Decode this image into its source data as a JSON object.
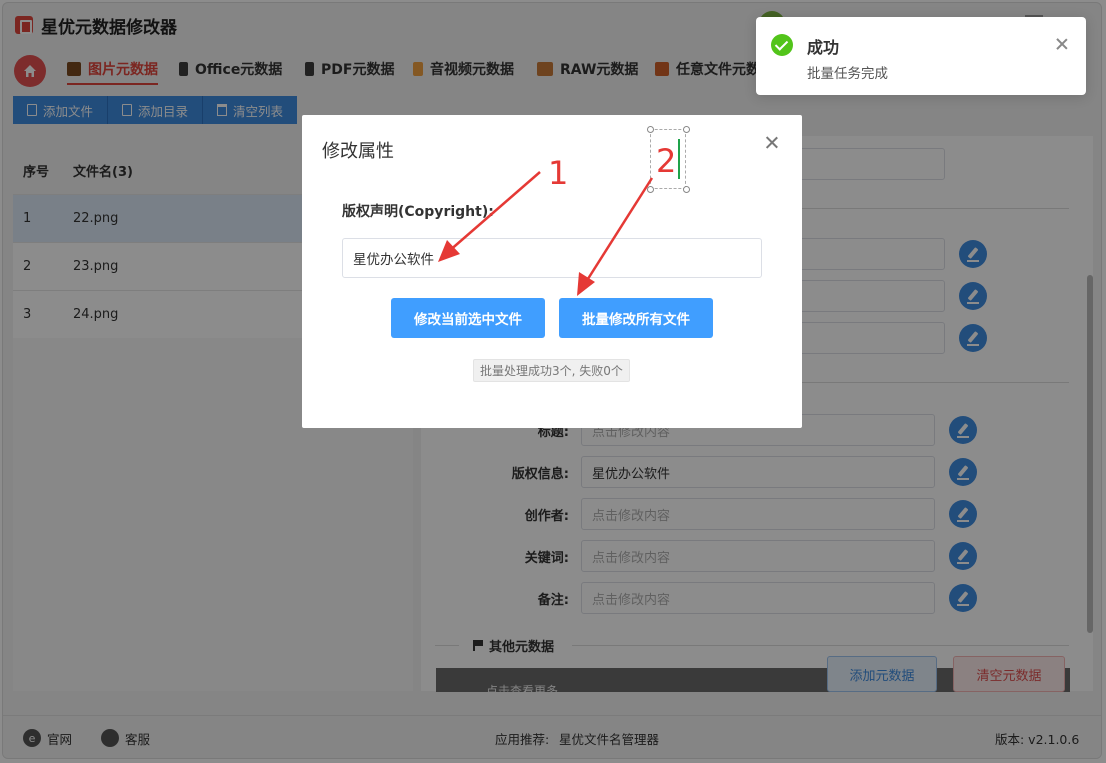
{
  "app": {
    "title": "星优元数据修改器"
  },
  "tabs": [
    {
      "label": "图片元数据",
      "icon": "image-icon",
      "color": "#e0463c"
    },
    {
      "label": "Office元数据",
      "icon": "office-icon",
      "color": "#333333"
    },
    {
      "label": "PDF元数据",
      "icon": "pdf-icon",
      "color": "#333333"
    },
    {
      "label": "音视频元数据",
      "icon": "media-icon",
      "color": "#333333"
    },
    {
      "label": "RAW元数据",
      "icon": "raw-icon",
      "color": "#333333"
    },
    {
      "label": "任意文件元数",
      "icon": "file-icon",
      "color": "#333333"
    }
  ],
  "toolbar": {
    "add_file": "添加文件",
    "add_dir": "添加目录",
    "clear_list": "清空列表"
  },
  "file_table": {
    "headers": [
      "序号",
      "文件名(3)"
    ],
    "rows": [
      {
        "index": "1",
        "name": "22.png"
      },
      {
        "index": "2",
        "name": "23.png"
      },
      {
        "index": "3",
        "name": "24.png"
      }
    ]
  },
  "fields": {
    "title_label": "标题:",
    "title_placeholder": "点击修改内容",
    "copyright_label": "版权信息:",
    "copyright_value": "星优办公软件",
    "author_label": "创作者:",
    "author_placeholder": "点击修改内容",
    "keywords_label": "关键词:",
    "keywords_placeholder": "点击修改内容",
    "notes_label": "备注:",
    "notes_placeholder": "点击修改内容"
  },
  "other_section": {
    "title": "其他元数据",
    "bar_text": "点击查看更多",
    "add_button": "添加元数据",
    "clear_button": "清空元数据"
  },
  "statusbar": {
    "website": "官网",
    "support": "客服",
    "recommend_label": "应用推荐:",
    "recommend_app": "星优文件名管理器",
    "version": "版本: v2.1.0.6"
  },
  "modal": {
    "title": "修改属性",
    "field_label": "版权声明(Copyright):",
    "field_value": "星优办公软件",
    "btn_current": "修改当前选中文件",
    "btn_all": "批量修改所有文件",
    "status": "批量处理成功3个, 失败0个"
  },
  "annotations": {
    "arrow1": "1",
    "arrow2": "2",
    "arrow_color": "#e53935"
  },
  "toast": {
    "title": "成功",
    "message": "批量任务完成",
    "color": "#52c41a"
  }
}
